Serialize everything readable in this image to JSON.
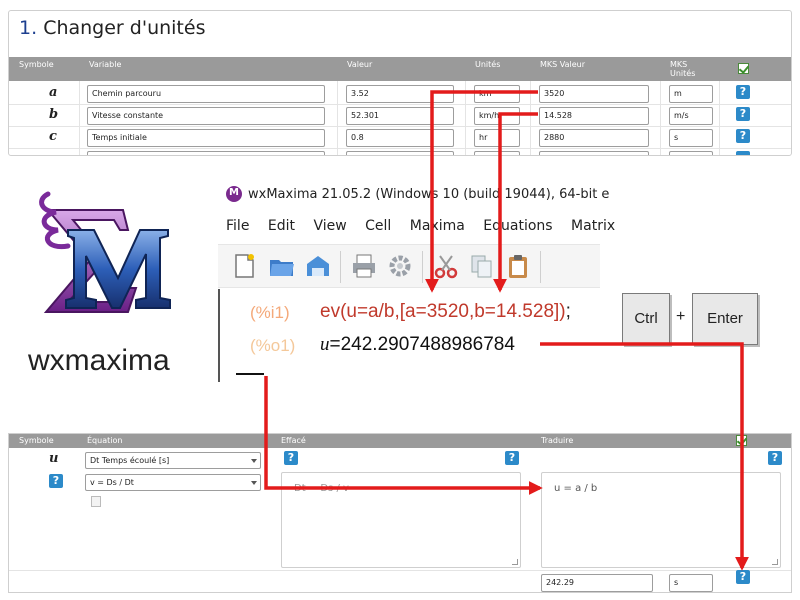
{
  "top": {
    "section_number": "1.",
    "title": "Changer d'unités",
    "headers": {
      "symbole": "Symbole",
      "variable": "Variable",
      "valeur": "Valeur",
      "unites": "Unités",
      "mks_valeur": "MKS Valeur",
      "mks_unites_1": "MKS",
      "mks_unites_2": "Unités"
    },
    "rows": [
      {
        "symbol": "a",
        "variable": "Chemin parcouru",
        "valeur": "3.52",
        "unite": "km",
        "mks_valeur": "3520",
        "mks_unite": "m"
      },
      {
        "symbol": "b",
        "variable": "Vitesse constante",
        "valeur": "52.301",
        "unite": "km/h",
        "mks_valeur": "14.528",
        "mks_unite": "m/s"
      },
      {
        "symbol": "c",
        "variable": "Temps initiale",
        "valeur": "0.8",
        "unite": "hr",
        "mks_valeur": "2880",
        "mks_unite": "s"
      }
    ],
    "help_label": "?"
  },
  "logo": {
    "label": "wxmaxima"
  },
  "wxmaxima": {
    "window_title": "wxMaxima 21.05.2 (Windows 10 (build 19044), 64-bit e",
    "menu": [
      "File",
      "Edit",
      "View",
      "Cell",
      "Maxima",
      "Equations",
      "Matrix"
    ],
    "input_label": "(%i1)",
    "input_fn": "ev(u=a/b,[a=3520,b=14.528])",
    "input_end": ";",
    "output_label": "(%o1)",
    "output_var": "u",
    "output_value": "=242.2907488986784"
  },
  "keys": {
    "ctrl": "Ctrl",
    "plus": "+",
    "enter": "Enter"
  },
  "bottom": {
    "headers": {
      "symbole": "Symbole",
      "equation": "Équation",
      "effacer": "Effacé",
      "traduire": "Traduire"
    },
    "symbol": "u",
    "select_1": "Dt Temps écoulé [s]",
    "select_2": "v = Ds / Dt",
    "effacer_text": "Dt = Ds / v",
    "traduire_text": "u = a / b",
    "result_value": "242.29",
    "result_unit": "s",
    "help_label": "?"
  }
}
